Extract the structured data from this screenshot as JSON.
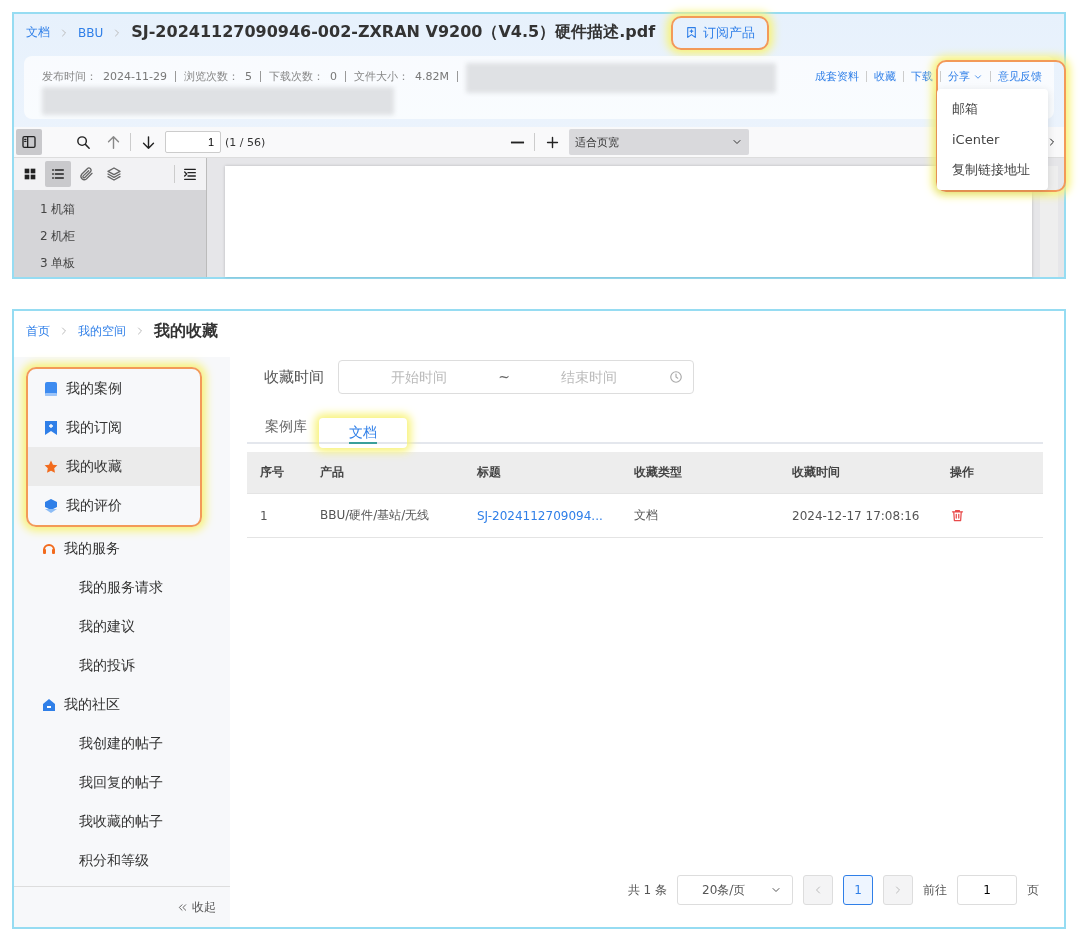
{
  "doc_viewer": {
    "breadcrumb": [
      {
        "label": "文档"
      },
      {
        "label": "BBU"
      }
    ],
    "title": "SJ-20241127090946-002-ZXRAN V9200（V4.5）硬件描述.pdf",
    "subscribe_button": {
      "label": "订阅产品",
      "highlighted": true
    },
    "meta": [
      {
        "label": "发布时间：",
        "value": "2024-11-29"
      },
      {
        "label": "浏览次数：",
        "value": "5"
      },
      {
        "label": "下载次数：",
        "value": "0"
      },
      {
        "label": "文件大小：",
        "value": "4.82M"
      }
    ],
    "actions": [
      {
        "label": "成套资料",
        "kind": "link"
      },
      {
        "label": "收藏",
        "kind": "link"
      },
      {
        "label": "下载",
        "kind": "link"
      },
      {
        "label": "分享",
        "kind": "menu",
        "highlighted": true,
        "menu": [
          "邮箱",
          "iCenter",
          "复制链接地址"
        ]
      },
      {
        "label": "意见反馈",
        "kind": "link"
      }
    ],
    "toolbar": {
      "page_input": "1",
      "page_count": "(1 / 56)",
      "zoom_select": "适合页宽"
    },
    "sidebar_tools": [
      {
        "kind": "grid",
        "selected": false
      },
      {
        "kind": "list",
        "selected": true
      },
      {
        "kind": "attachment",
        "selected": false
      },
      {
        "kind": "layers",
        "selected": false
      }
    ],
    "outline": [
      "1 机箱",
      "2 机柜",
      "3 单板"
    ]
  },
  "favorites_page": {
    "breadcrumb": [
      {
        "label": "首页"
      },
      {
        "label": "我的空间"
      }
    ],
    "page_title": "我的收藏",
    "sidebar": {
      "items": [
        {
          "label": "我的案例",
          "kind": "book",
          "selected": false,
          "highlighted": true
        },
        {
          "label": "我的订阅",
          "kind": "bookmark",
          "selected": false,
          "highlighted": true
        },
        {
          "label": "我的收藏",
          "kind": "star",
          "selected": true,
          "highlighted": true
        },
        {
          "label": "我的评价",
          "kind": "badge",
          "selected": false,
          "highlighted": true
        },
        {
          "label": "我的服务",
          "kind": "headset",
          "selected": false,
          "highlighted": false,
          "children": [
            {
              "label": "我的服务请求",
              "selected": false
            },
            {
              "label": "我的建议",
              "selected": false
            },
            {
              "label": "我的投诉",
              "selected": false
            }
          ]
        },
        {
          "label": "我的社区",
          "kind": "home",
          "selected": false,
          "highlighted": false,
          "children": [
            {
              "label": "我创建的帖子",
              "selected": false
            },
            {
              "label": "我回复的帖子",
              "selected": false
            },
            {
              "label": "我收藏的帖子",
              "selected": false
            },
            {
              "label": "积分和等级",
              "selected": false
            }
          ]
        }
      ],
      "collapse": "收起"
    },
    "filter": {
      "label": "收藏时间",
      "start_placeholder": "开始时间",
      "separator": "~",
      "end_placeholder": "结束时间"
    },
    "tabs": [
      {
        "label": "案例库",
        "selected": false,
        "highlighted": false
      },
      {
        "label": "文档",
        "selected": true,
        "highlighted": true
      }
    ],
    "table": {
      "columns": [
        "序号",
        "产品",
        "标题",
        "收藏类型",
        "收藏时间",
        "操作"
      ],
      "rows": [
        {
          "index": "1",
          "product": "BBU/硬件/基站/无线",
          "title": "SJ-2024112709094...",
          "type": "文档",
          "time": "2024-12-17 17:08:16"
        }
      ]
    },
    "pagination": {
      "total": "共 1 条",
      "page_size": "20条/页",
      "prev_disabled": true,
      "pages": [
        {
          "label": "1",
          "selected": true
        }
      ],
      "next_disabled": true,
      "goto_label": "前往",
      "goto_value": "1",
      "goto_suffix": "页"
    }
  }
}
